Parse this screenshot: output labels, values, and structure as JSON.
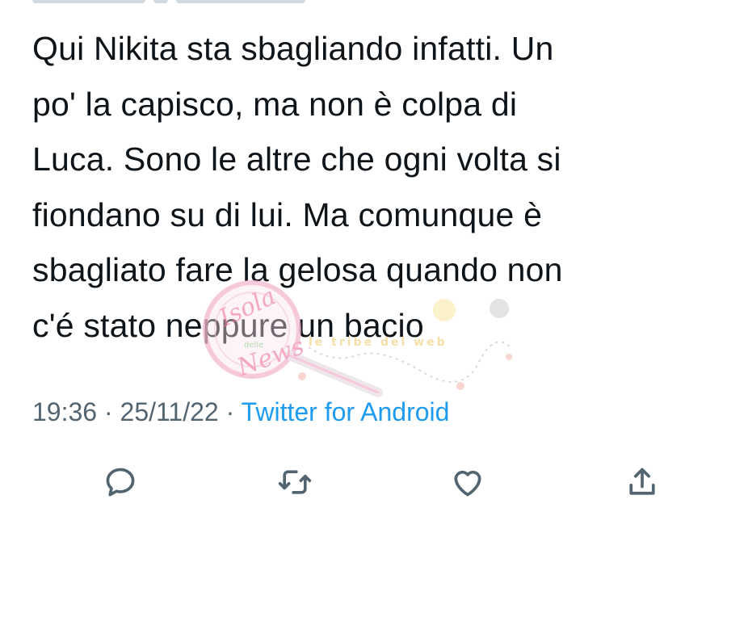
{
  "tweet": {
    "text": "Qui Nikita sta sbagliando infatti. Un\npo' la capisco, ma non è colpa di\nLuca. Sono le altre che ogni volta si\nfiondano su di lui. Ma comunque è\nsbagliato fare la gelosa quando non\nc'é stato neppure un bacio",
    "time": "19:36",
    "date": "25/11/22",
    "separator": "·",
    "source": "Twitter for Android"
  },
  "actions": {
    "reply_icon": "reply-icon",
    "retweet_icon": "retweet-icon",
    "like_icon": "heart-icon",
    "share_icon": "share-icon"
  },
  "watermark": {
    "line1": "Isola",
    "line2": "News",
    "small": "delle",
    "banner": "le tribe del web"
  },
  "colors": {
    "text": "#0f1419",
    "meta": "#536471",
    "link": "#1d9bf0",
    "watermark_pink": "#f3b8cf"
  }
}
